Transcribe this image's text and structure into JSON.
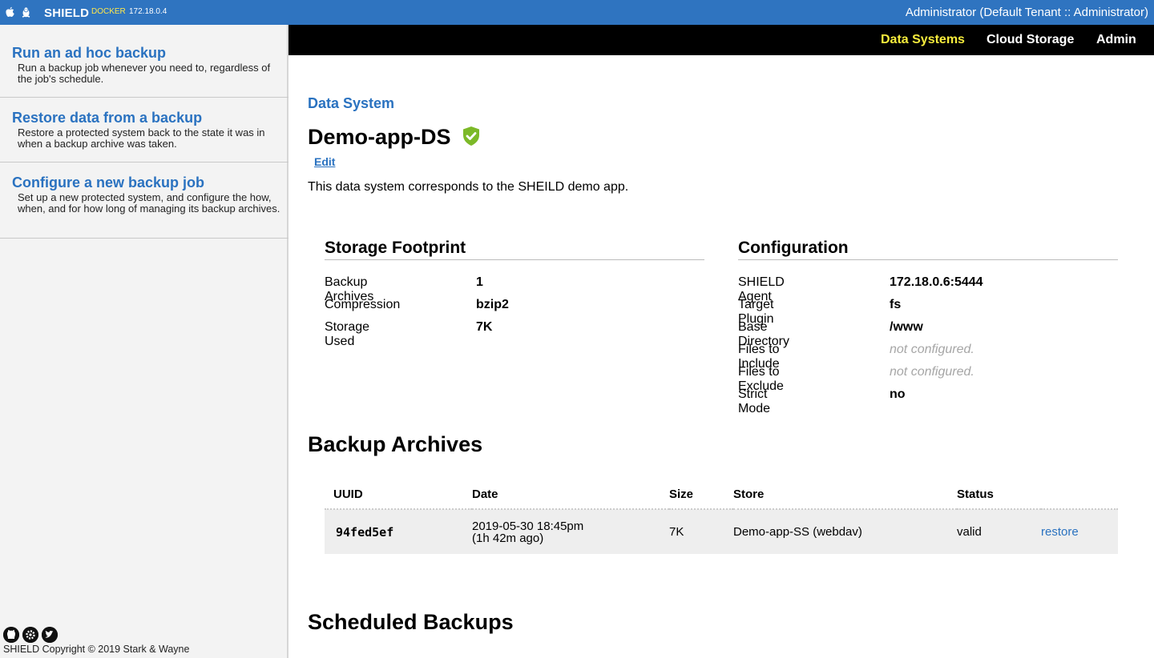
{
  "topbar": {
    "brand": "SHIELD",
    "env": "DOCKER",
    "ip": "172.18.0.4",
    "user": "Administrator (Default Tenant :: Administrator)",
    "icons": [
      "apple-icon",
      "linux-icon"
    ]
  },
  "sidebar": {
    "items": [
      {
        "title": "Run an ad hoc backup",
        "desc": "Run a backup job whenever you need to, regardless of the job's schedule."
      },
      {
        "title": "Restore data from a backup",
        "desc": "Restore a protected system back to the state it was in when a backup archive was taken."
      },
      {
        "title": "Configure a new backup job",
        "desc": "Set up a new protected system, and configure the how, when, and for how long of managing its backup archives."
      }
    ],
    "footer_icons": [
      "github-icon",
      "settings-icon",
      "twitter-icon"
    ],
    "copyright": "SHIELD Copyright © 2019 Stark & Wayne"
  },
  "nav": {
    "items": [
      "Data Systems",
      "Cloud Storage",
      "Admin"
    ],
    "active": "Data Systems"
  },
  "page": {
    "breadcrumb": "Data System",
    "title": "Demo-app-DS",
    "status_icon": "shield-check-icon",
    "edit": "Edit",
    "description": "This data system corresponds to the SHEILD demo app."
  },
  "storage": {
    "heading": "Storage Footprint",
    "rows": [
      {
        "label": "Backup Archives",
        "value": "1"
      },
      {
        "label": "Compression",
        "value": "bzip2"
      },
      {
        "label": "Storage Used",
        "value": "7K"
      }
    ]
  },
  "config": {
    "heading": "Configuration",
    "rows": [
      {
        "label": "SHIELD Agent",
        "value": "172.18.0.6:5444"
      },
      {
        "label": "Target Plugin",
        "value": "fs"
      },
      {
        "label": "Base Directory",
        "value": "/www"
      },
      {
        "label": "Files to Include",
        "value": "not configured."
      },
      {
        "label": "Files to Exclude",
        "value": "not configured."
      },
      {
        "label": "Strict Mode",
        "value": "no"
      }
    ]
  },
  "archives": {
    "heading": "Backup Archives",
    "columns": [
      "UUID",
      "Date",
      "Size",
      "Store",
      "Status"
    ],
    "rows": [
      {
        "uuid": "94fed5ef",
        "date": "2019-05-30 18:45pm",
        "ago": "(1h 42m ago)",
        "size": "7K",
        "store": "Demo-app-SS (webdav)",
        "status": "valid",
        "action": "restore"
      }
    ]
  },
  "scheduled": {
    "heading": "Scheduled Backups"
  },
  "colors": {
    "topbar": "#2f74c0",
    "link": "#2a72c0",
    "nav_active": "#f6ec3c",
    "env": "#ffe74a",
    "status_ok": "#7cb928"
  }
}
